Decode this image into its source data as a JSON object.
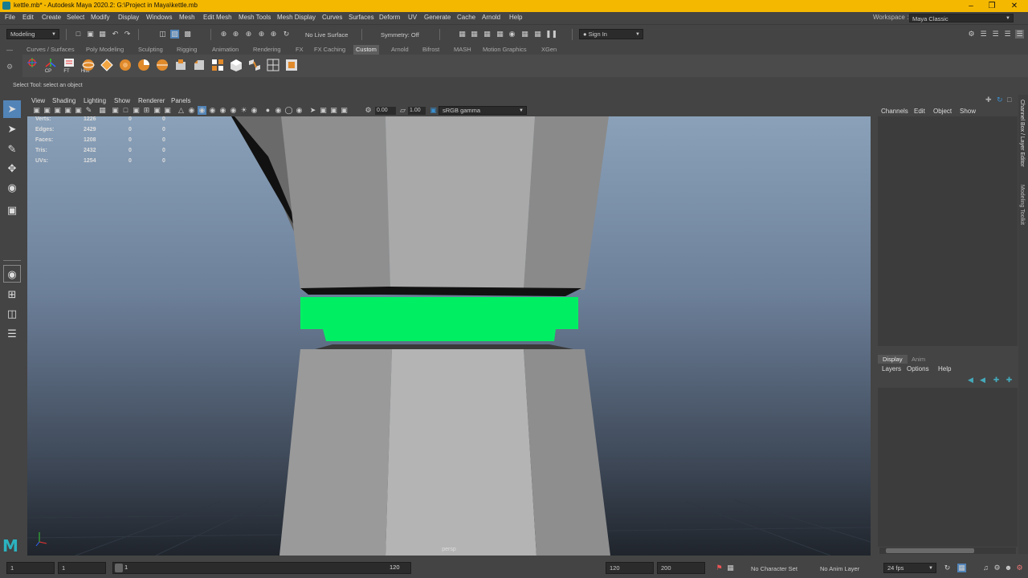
{
  "window": {
    "title": "kettle.mb* - Autodesk Maya 2020.2: G:\\Project in Maya\\kettle.mb"
  },
  "menubar": {
    "items": [
      "File",
      "Edit",
      "Create",
      "Select",
      "Modify",
      "Display",
      "Windows",
      "Mesh",
      "Edit Mesh",
      "Mesh Tools",
      "Mesh Display",
      "Curves",
      "Surfaces",
      "Deform",
      "UV",
      "Generate",
      "Cache",
      "Arnold",
      "Help"
    ],
    "workspace_label": "Workspace :",
    "workspace_value": "Maya Classic"
  },
  "statusline": {
    "mode": "Modeling",
    "live_surface": "No Live Surface",
    "symmetry": "Symmetry: Off",
    "sign_in": "Sign In"
  },
  "shelf": {
    "tabs": [
      "Curves / Surfaces",
      "Poly Modeling",
      "Sculpting",
      "Rigging",
      "Animation",
      "Rendering",
      "FX",
      "FX Caching",
      "Custom",
      "Arnold",
      "Bifrost",
      "MASH",
      "Motion Graphics",
      "XGen"
    ],
    "active_tab": "Custom",
    "buttons": [
      "CP",
      "FT",
      "Hist"
    ]
  },
  "helpline": {
    "text": "Select Tool: select an object"
  },
  "viewport": {
    "menu": [
      "View",
      "Shading",
      "Lighting",
      "Show",
      "Renderer",
      "Panels"
    ],
    "exposure": "0.00",
    "gamma": "1.00",
    "color_space": "sRGB gamma",
    "camera": "persp",
    "hud": [
      {
        "label": "Verts:",
        "v1": "1226",
        "v2": "0",
        "v3": "0"
      },
      {
        "label": "Edges:",
        "v1": "2429",
        "v2": "0",
        "v3": "0"
      },
      {
        "label": "Faces:",
        "v1": "1208",
        "v2": "0",
        "v3": "0"
      },
      {
        "label": "Tris:",
        "v1": "2432",
        "v2": "0",
        "v3": "0"
      },
      {
        "label": "UVs:",
        "v1": "1254",
        "v2": "0",
        "v3": "0"
      }
    ],
    "selection_color": "#00ef62",
    "mesh_color": "#a9a9a9"
  },
  "channel_box": {
    "menu": [
      "Channels",
      "Edit",
      "Object",
      "Show"
    ]
  },
  "layer_editor": {
    "tabs": [
      "Display",
      "Anim"
    ],
    "menu": [
      "Layers",
      "Options",
      "Help"
    ]
  },
  "side_tabs": [
    "Channel Box / Layer Editor",
    "Modeling Toolkit"
  ],
  "timeline": {
    "start": "1",
    "current": "1",
    "slider_start": "1",
    "slider_end": "120",
    "range_end": "120",
    "anim_end": "200",
    "character_set": "No Character Set",
    "anim_layer": "No Anim Layer",
    "fps": "24 fps"
  }
}
